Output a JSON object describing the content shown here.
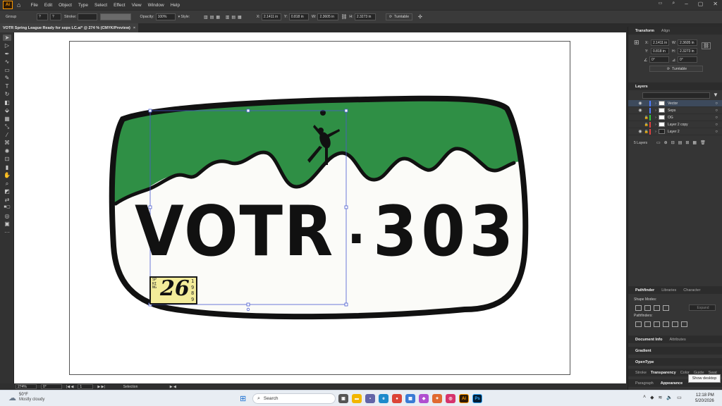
{
  "menu": {
    "app_logo": "Ai",
    "items": [
      "File",
      "Edit",
      "Object",
      "Type",
      "Select",
      "Effect",
      "View",
      "Window",
      "Help"
    ]
  },
  "control_bar": {
    "selection_label": "Group",
    "stroke_label": "Stroke:",
    "opacity_label": "Opacity:",
    "opacity_value": "100%",
    "x_label": "X:",
    "x_value": "2.1411 in",
    "y_label": "Y:",
    "y_value": "0.818 in",
    "w_label": "W:",
    "w_value": "2.3605 in",
    "h_label": "H:",
    "h_value": "2.3273 in",
    "turntable_label": "Turntable"
  },
  "document_tab": {
    "title": "VOTR Spring League Ready for seps LC.ai* @ 274 % (CMYK/Preview)",
    "close": "×"
  },
  "artwork": {
    "plate_text_left": "VOTR",
    "plate_text_right": "303",
    "dot": "·",
    "sticker_number": "26",
    "sticker_left": "SPRING",
    "sticker_right": "1989",
    "green_color": "#2f8f45",
    "plate_bg_color": "#fbfbf8"
  },
  "status_bar": {
    "zoom": "274%",
    "rotation": "0°",
    "artboard_num": "1",
    "mode": "Selection"
  },
  "transform_panel": {
    "tabs": [
      "Transform",
      "Align"
    ],
    "x_label": "X:",
    "x_value": "2.1411 in",
    "w_label": "W:",
    "w_value": "2.3605 in",
    "y_label": "Y:",
    "y_value": "0.818 in",
    "h_label": "H:",
    "h_value": "2.3273 in",
    "angle_value": "0°",
    "shear_value": "0°",
    "turntable_button": "Turntable"
  },
  "layers_panel": {
    "title": "Layers",
    "search_placeholder": "",
    "layers": [
      {
        "name": "Vector",
        "color": "#4f7cff",
        "locked": false,
        "visible": true
      },
      {
        "name": "Seps",
        "color": "#4f7cff",
        "locked": false,
        "visible": true
      },
      {
        "name": "OG",
        "color": "#2fc93c",
        "locked": true,
        "visible": false
      },
      {
        "name": "Layer 2 copy",
        "color": "#e04040",
        "locked": true,
        "visible": false
      },
      {
        "name": "Layer 2",
        "color": "#e04040",
        "locked": true,
        "visible": true
      }
    ],
    "count_label": "5 Layers"
  },
  "pathfinder_panel": {
    "tabs": [
      "Pathfinder",
      "Libraries",
      "Character"
    ],
    "shape_modes_label": "Shape Modes:",
    "pathfinders_label": "Pathfinders:",
    "expand_button": "Expand"
  },
  "collapsed_panels": {
    "doc_info_tabs": [
      "Document Info",
      "Attributes"
    ],
    "gradient": "Gradient",
    "opentype": "OpenType",
    "bottom_tabs": [
      "Stroke",
      "Transparency",
      "Color",
      "Guide",
      "Swat"
    ],
    "bottom_tabs2": [
      "Paragraph",
      "Appearance"
    ]
  },
  "taskbar": {
    "weather_temp": "50°F",
    "weather_desc": "Mostly cloudy",
    "search_label": "Search",
    "time": "12:18 PM",
    "date": "5/20/2026",
    "tooltip": "Show desktop"
  }
}
